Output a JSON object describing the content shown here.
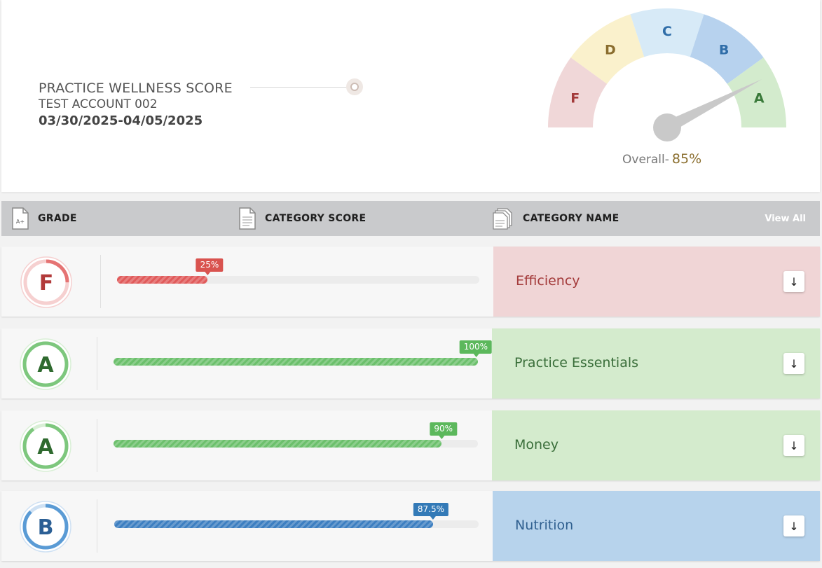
{
  "header": {
    "title": "PRACTICE WELLNESS SCORE",
    "account": "TEST ACCOUNT 002",
    "date_range": "03/30/2025-04/05/2025"
  },
  "gauge": {
    "segments": [
      {
        "label": "F",
        "fill": "#f0d7d8",
        "text": "#a33a3a"
      },
      {
        "label": "D",
        "fill": "#faf1cc",
        "text": "#8a6d2e"
      },
      {
        "label": "C",
        "fill": "#d7eaf7",
        "text": "#2f6da8"
      },
      {
        "label": "B",
        "fill": "#b7d2ee",
        "text": "#2f6da8"
      },
      {
        "label": "A",
        "fill": "#d3ebcd",
        "text": "#3a7a3a"
      }
    ],
    "overall_label": "Overall-",
    "overall_value": "85%",
    "overall_fraction": 0.85
  },
  "table": {
    "headers": {
      "grade": "GRADE",
      "score": "CATEGORY SCORE",
      "name": "CATEGORY NAME",
      "view_all": "View All"
    },
    "rows": [
      {
        "grade": "F",
        "score_label": "25%",
        "score": 0.25,
        "name": "Efficiency",
        "bar_color": "#e05a5a",
        "tip_color": "#d9534f",
        "ring_color": "#e57373",
        "ring_light": "#f6d0d0",
        "grade_color": "#b23a3a",
        "panel_color": "#f0d5d6",
        "name_color": "#a33a3a",
        "arrow": "↓"
      },
      {
        "grade": "A",
        "score_label": "100%",
        "score": 1.0,
        "name": "Practice Essentials",
        "bar_color": "#6cc06c",
        "tip_color": "#5cb85c",
        "ring_color": "#7dc77d",
        "ring_light": "#d9efd6",
        "grade_color": "#2f6a2f",
        "panel_color": "#d4ebcd",
        "name_color": "#3a6e3a",
        "arrow": "↓"
      },
      {
        "grade": "A",
        "score_label": "90%",
        "score": 0.9,
        "name": "Money",
        "bar_color": "#6cc06c",
        "tip_color": "#5cb85c",
        "ring_color": "#7dc77d",
        "ring_light": "#d9efd6",
        "grade_color": "#2f6a2f",
        "panel_color": "#d4ebcd",
        "name_color": "#3a6e3a",
        "arrow": "↓"
      },
      {
        "grade": "B",
        "score_label": "87.5%",
        "score": 0.875,
        "name": "Nutrition",
        "bar_color": "#3d7fc1",
        "tip_color": "#337ab7",
        "ring_color": "#5a9bd5",
        "ring_light": "#cfe1f3",
        "grade_color": "#2b5f95",
        "panel_color": "#b7d3ec",
        "name_color": "#2f5f8f",
        "arrow": "↓"
      }
    ]
  }
}
